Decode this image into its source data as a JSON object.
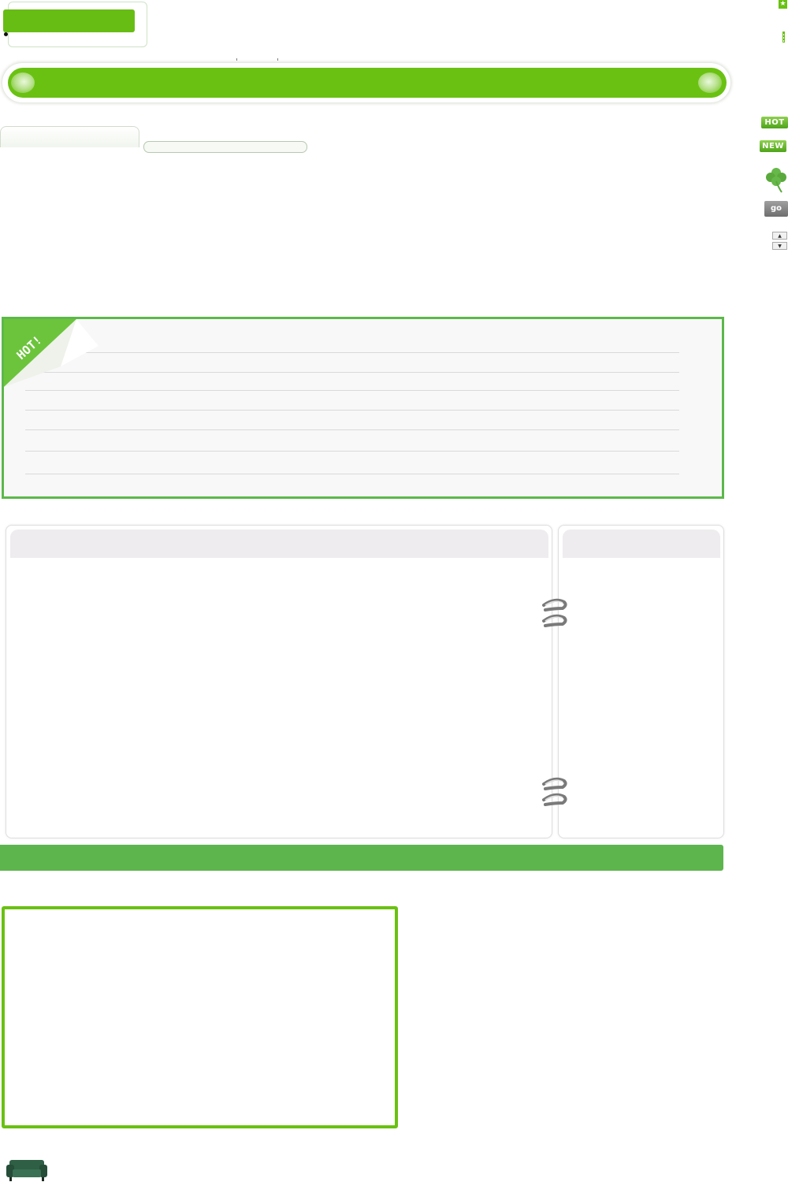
{
  "badges": {
    "hot": "HOT",
    "new": "NEW"
  },
  "buttons": {
    "go": "go"
  },
  "ribbon": {
    "text": "HOT!"
  },
  "colors": {
    "brand_green": "#6ac112",
    "panel_border": "#5cb849",
    "footer_green": "#5db54e",
    "tab_header_grey": "#eeecee"
  },
  "icons": {
    "top_right": "star-icon",
    "clover": "four-leaf-clover-icon",
    "spinner_up": "triangle-up-icon",
    "spinner_down": "triangle-down-icon",
    "rings": "notebook-ring-icon",
    "sofa": "sofa-icon"
  }
}
